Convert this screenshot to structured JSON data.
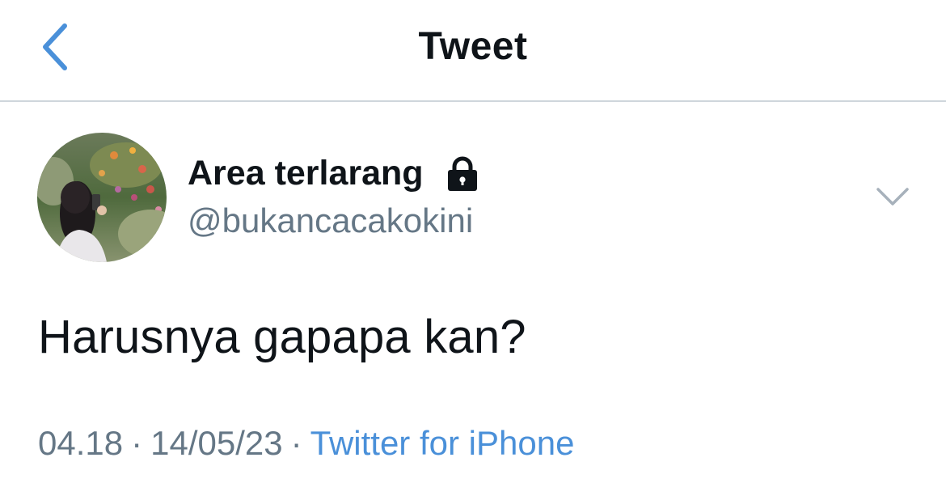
{
  "nav": {
    "title": "Tweet",
    "back_icon": "chevron-left-icon",
    "accent_color": "#4a90d9"
  },
  "author": {
    "display_name": "Area terlarang",
    "handle": "@bukancacakokini",
    "protected_icon": "lock-icon",
    "avatar_description": "photo avatar"
  },
  "tweet": {
    "text": "Harusnya gapapa kan?",
    "time": "04.18",
    "date": "14/05/23",
    "separator": "·",
    "client": "Twitter for iPhone"
  },
  "menu": {
    "icon": "chevron-down-icon"
  }
}
